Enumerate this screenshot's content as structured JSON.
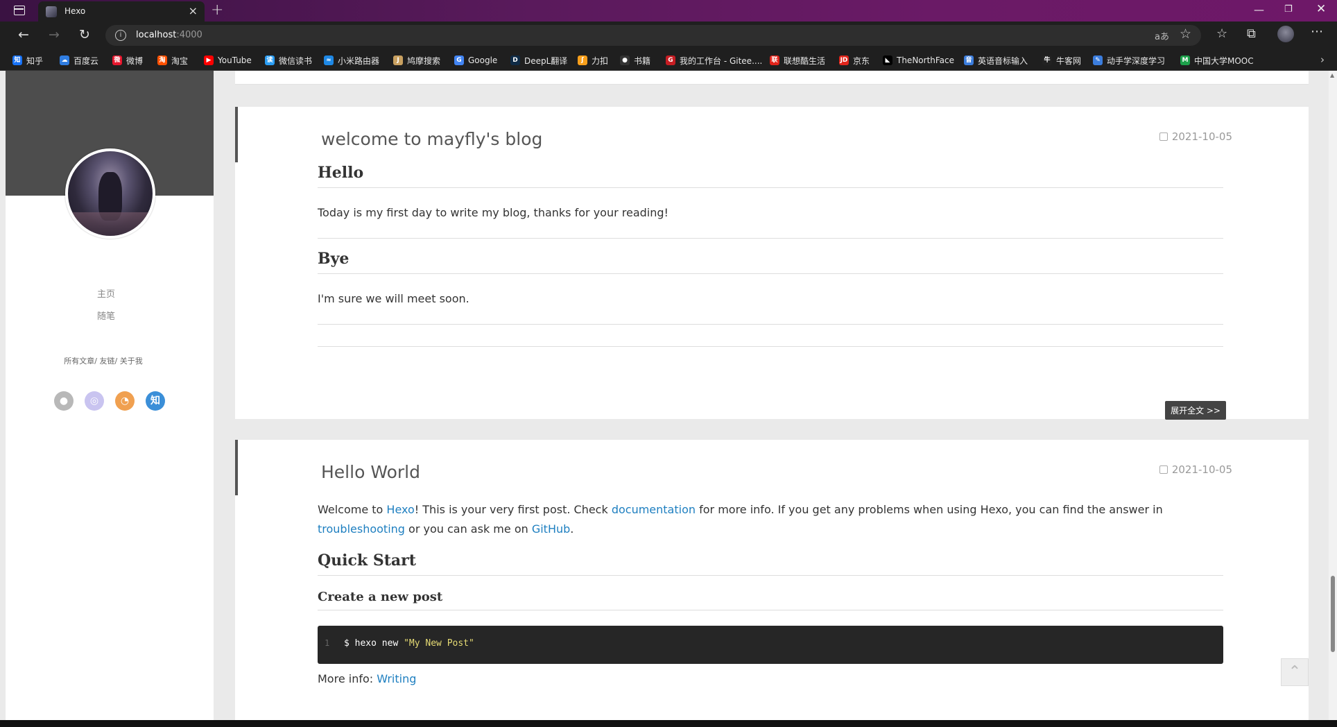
{
  "browser": {
    "tab_title": "Hexo",
    "url_host": "localhost",
    "url_port": ":4000",
    "read_aloud": "aあ",
    "bookmarks": [
      {
        "label": "知乎",
        "icon": "zhihu-icon",
        "color": "#1772f6",
        "glyph": "知"
      },
      {
        "label": "百度云",
        "icon": "baidu-cloud-icon",
        "color": "#2f7de1",
        "glyph": "☁"
      },
      {
        "label": "微博",
        "icon": "weibo-icon",
        "color": "#e6162d",
        "glyph": "微"
      },
      {
        "label": "淘宝",
        "icon": "taobao-icon",
        "color": "#ff5000",
        "glyph": "淘"
      },
      {
        "label": "YouTube",
        "icon": "youtube-icon",
        "color": "#ff0000",
        "glyph": "▶"
      },
      {
        "label": "微信读书",
        "icon": "weread-icon",
        "color": "#2a9df4",
        "glyph": "读"
      },
      {
        "label": "小米路由器",
        "icon": "wifi-icon",
        "color": "#1e88e5",
        "glyph": "≈"
      },
      {
        "label": "鸠摩搜索",
        "icon": "jiumo-icon",
        "color": "#c8a060",
        "glyph": "J"
      },
      {
        "label": "Google",
        "icon": "google-icon",
        "color": "#4285f4",
        "glyph": "G"
      },
      {
        "label": "DeepL翻译",
        "icon": "deepl-icon",
        "color": "#0f2b46",
        "glyph": "D"
      },
      {
        "label": "力扣",
        "icon": "leetcode-icon",
        "color": "#f89f1b",
        "glyph": "ʃ"
      },
      {
        "label": "书籍",
        "icon": "github-icon",
        "color": "#333333",
        "glyph": "●"
      },
      {
        "label": "我的工作台 - Gitee....",
        "icon": "gitee-icon",
        "color": "#c71d23",
        "glyph": "G"
      },
      {
        "label": "联想酷生活",
        "icon": "lenovo-icon",
        "color": "#e2231a",
        "glyph": "联"
      },
      {
        "label": "京东",
        "icon": "jd-icon",
        "color": "#e1251b",
        "glyph": "JD"
      },
      {
        "label": "TheNorthFace",
        "icon": "northface-icon",
        "color": "#000000",
        "glyph": "◣"
      },
      {
        "label": "英语音标输入",
        "icon": "phonetic-icon",
        "color": "#3b7ddd",
        "glyph": "音"
      },
      {
        "label": "牛客网",
        "icon": "nowcoder-icon",
        "color": "#222222",
        "glyph": "牛"
      },
      {
        "label": "动手学深度学习",
        "icon": "d2l-icon",
        "color": "#3b7ddd",
        "glyph": "✎"
      },
      {
        "label": "中国大学MOOC",
        "icon": "mooc-icon",
        "color": "#1ca04a",
        "glyph": "M"
      }
    ]
  },
  "sidebar": {
    "nav": [
      "主页",
      "随笔"
    ],
    "sub_links": "所有文章/ 友链/ 关于我",
    "social": [
      {
        "icon": "github-icon",
        "color": "#b8b8b8",
        "glyph": "●"
      },
      {
        "icon": "weibo-icon",
        "color": "#c9c4f0",
        "glyph": "◎"
      },
      {
        "icon": "rss-icon",
        "color": "#f0a050",
        "glyph": "◔"
      },
      {
        "icon": "zhihu-icon",
        "color": "#3b8fd8",
        "glyph": "知"
      }
    ]
  },
  "posts": [
    {
      "title": "welcome to mayfly's blog",
      "date": "2021-10-05",
      "h_hello": "Hello",
      "p_hello": "Today is my first day to write my blog, thanks for your reading!",
      "h_bye": "Bye",
      "p_bye": "I'm sure we will meet soon.",
      "read_more": "展开全文 >>"
    },
    {
      "title": "Hello World",
      "date": "2021-10-05",
      "intro_1": "Welcome to ",
      "link_hexo": "Hexo",
      "intro_2": "! This is your very first post. Check ",
      "link_docs": "documentation",
      "intro_3": " for more info. If you get any problems when using Hexo, you can find the answer in ",
      "link_trouble": "troubleshooting",
      "intro_4": " or you can ask me on ",
      "link_github": "GitHub",
      "intro_5": ".",
      "h_quick": "Quick Start",
      "h_create": "Create a new post",
      "code_lineno": "1",
      "code_cmd": "$ hexo new ",
      "code_arg": "\"My New Post\"",
      "more_info": "More info: ",
      "link_writing": "Writing"
    }
  ]
}
